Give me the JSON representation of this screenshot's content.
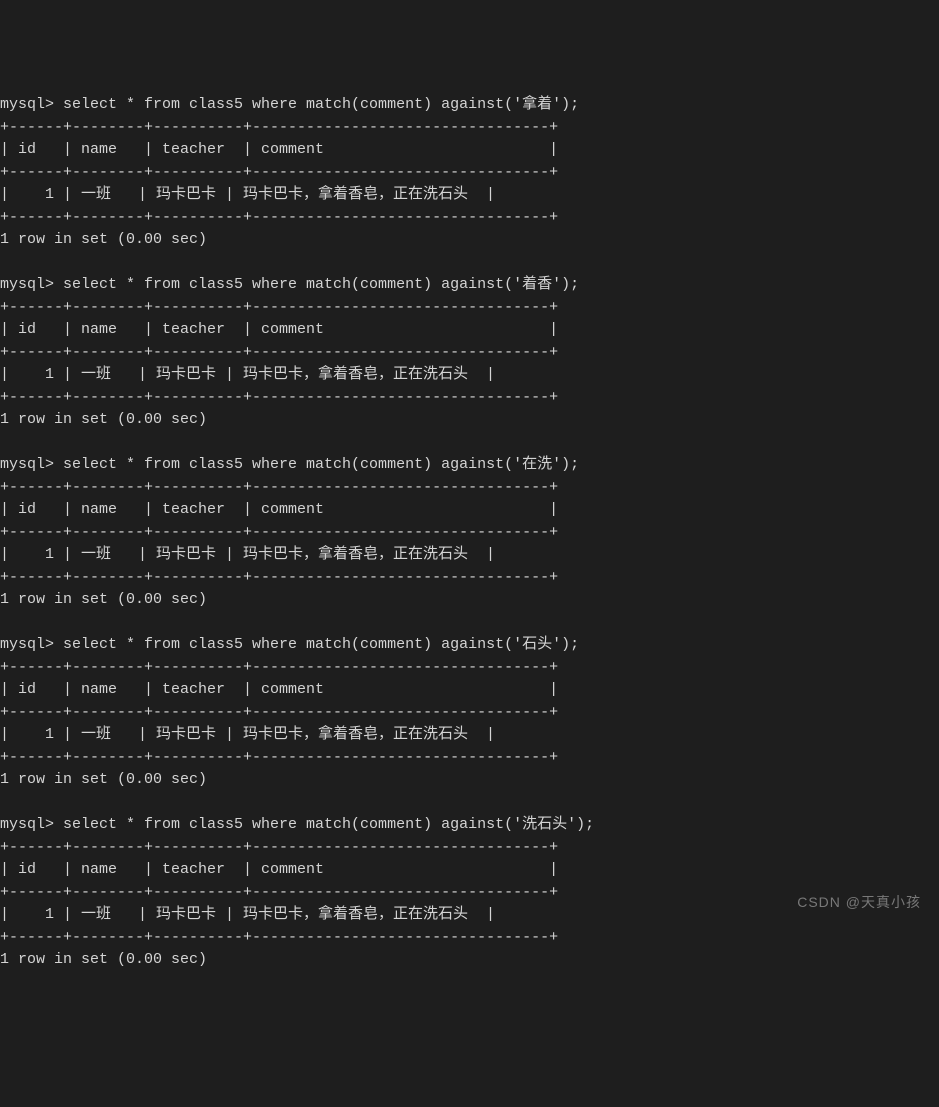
{
  "prompt": "mysql>",
  "queries": [
    {
      "sql": "select * from class5 where match(comment) against('拿着');",
      "columns": [
        "id",
        "name",
        "teacher",
        "comment"
      ],
      "rows": [
        {
          "id": "1",
          "name": "一班",
          "teacher": "玛卡巴卡",
          "comment": "玛卡巴卡，拿着香皂，正在洗石头"
        }
      ],
      "footer": "1 row in set (0.00 sec)"
    },
    {
      "sql": "select * from class5 where match(comment) against('着香');",
      "columns": [
        "id",
        "name",
        "teacher",
        "comment"
      ],
      "rows": [
        {
          "id": "1",
          "name": "一班",
          "teacher": "玛卡巴卡",
          "comment": "玛卡巴卡，拿着香皂，正在洗石头"
        }
      ],
      "footer": "1 row in set (0.00 sec)"
    },
    {
      "sql": "select * from class5 where match(comment) against('在洗');",
      "columns": [
        "id",
        "name",
        "teacher",
        "comment"
      ],
      "rows": [
        {
          "id": "1",
          "name": "一班",
          "teacher": "玛卡巴卡",
          "comment": "玛卡巴卡，拿着香皂，正在洗石头"
        }
      ],
      "footer": "1 row in set (0.00 sec)"
    },
    {
      "sql": "select * from class5 where match(comment) against('石头');",
      "columns": [
        "id",
        "name",
        "teacher",
        "comment"
      ],
      "rows": [
        {
          "id": "1",
          "name": "一班",
          "teacher": "玛卡巴卡",
          "comment": "玛卡巴卡，拿着香皂，正在洗石头"
        }
      ],
      "footer": "1 row in set (0.00 sec)"
    },
    {
      "sql": "select * from class5 where match(comment) against('洗石头');",
      "columns": [
        "id",
        "name",
        "teacher",
        "comment"
      ],
      "rows": [
        {
          "id": "1",
          "name": "一班",
          "teacher": "玛卡巴卡",
          "comment": "玛卡巴卡，拿着香皂，正在洗石头"
        }
      ],
      "footer": "1 row in set (0.00 sec)"
    }
  ],
  "border": "+------+--------+----------+---------------------------------+",
  "header_row": "| id   | name   | teacher  | comment                         |",
  "data_row": "|    1 | 一班   | 玛卡巴卡 | 玛卡巴卡，拿着香皂，正在洗石头  |",
  "watermark": "CSDN @天真小孩"
}
